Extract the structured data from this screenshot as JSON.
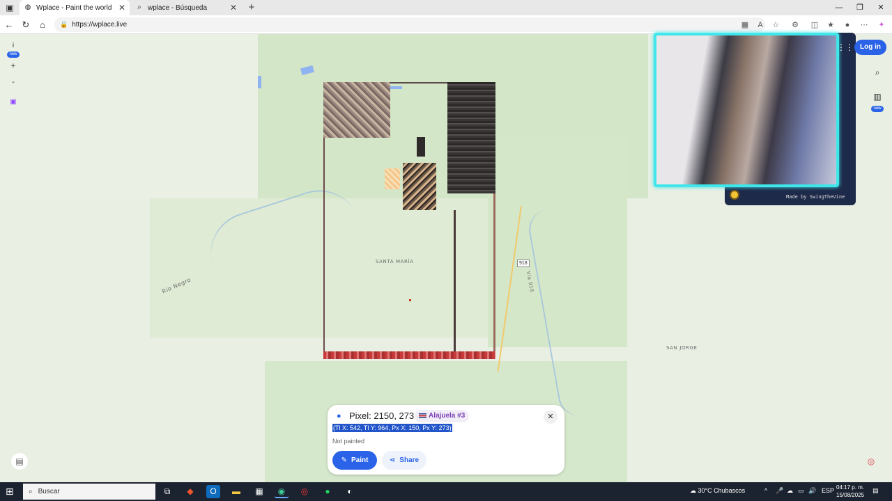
{
  "browser": {
    "tabs": [
      {
        "title": "Wplace - Paint the world",
        "favicon": "globe-icon",
        "active": true
      },
      {
        "title": "wplace - Búsqueda",
        "favicon": "search-icon",
        "active": false
      }
    ],
    "new_tab": "+",
    "url": "https://wplace.live",
    "window_controls": {
      "minimize": "—",
      "maximize": "❐",
      "close": "✕"
    }
  },
  "left_controls": {
    "info": "i",
    "info_badge": "new",
    "zoom_in": "+",
    "zoom_out": "-",
    "twitch": "⌂"
  },
  "right_controls": {
    "login": "Log in",
    "leaderboard_badge": "new"
  },
  "map": {
    "labels": [
      "SANTA MARÍA",
      "SAN JORGE",
      "Río Negro",
      "Vía 918"
    ],
    "road_shield": "918"
  },
  "webcam": {
    "credit": "Made by SwingTheVine"
  },
  "pixel_popup": {
    "title": "Pixel: 2150, 273",
    "alliance": "Alajuela #3",
    "coords": "(Tl X: 542, Tl Y: 964, Px X: 150, Px Y: 273)",
    "status": "Not painted",
    "paint_label": "Paint",
    "share_label": "Share"
  },
  "taskbar": {
    "search_placeholder": "Buscar",
    "weather": "30°C  Chubascos",
    "language": "ESP",
    "time": "04:17 p. m.",
    "date": "15/08/2025"
  },
  "colors": {
    "accent": "#2a63e8",
    "webcam_border": "#3fe6ea",
    "alliance_text": "#7b3fb5"
  }
}
